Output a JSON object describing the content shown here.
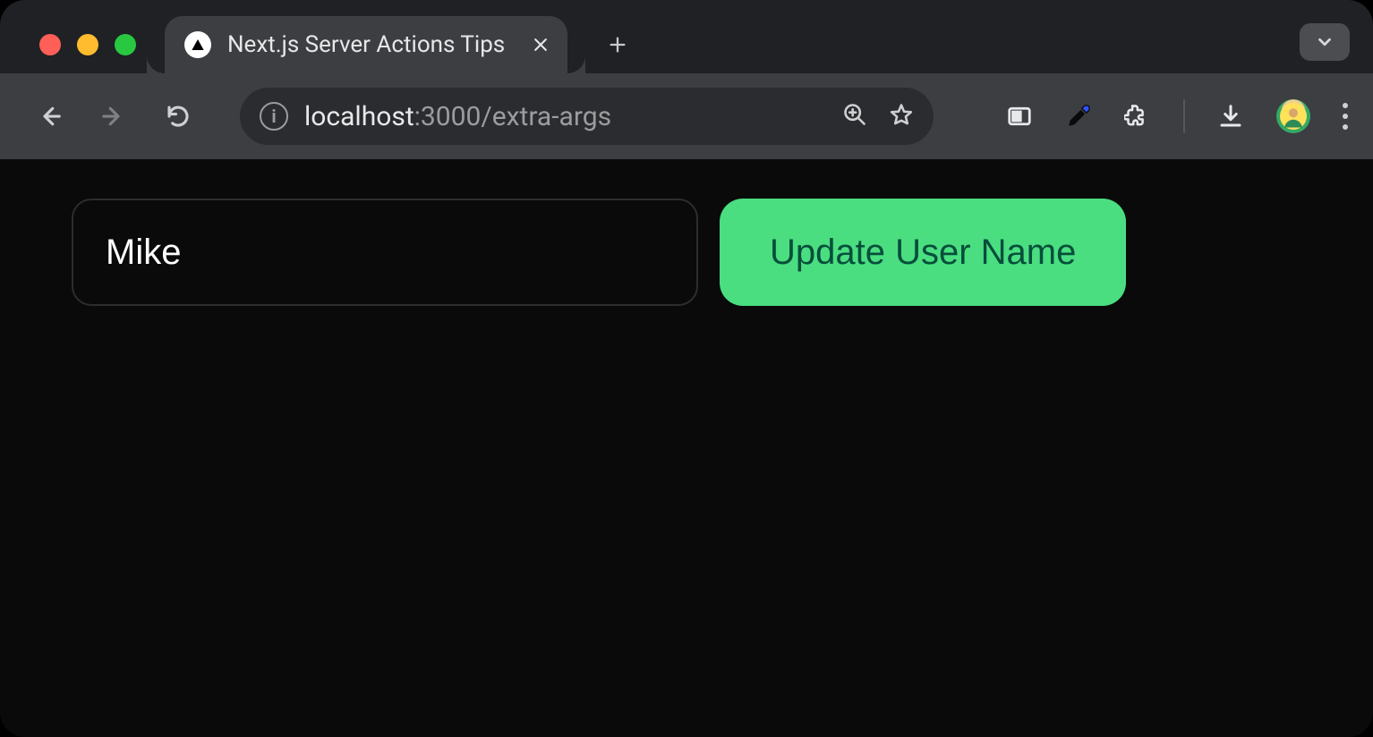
{
  "browser": {
    "tab": {
      "title": "Next.js Server Actions Tips"
    },
    "address": {
      "host": "localhost",
      "port_path": ":3000/extra-args"
    }
  },
  "page": {
    "name_input": {
      "value": "Mike"
    },
    "update_button_label": "Update User Name"
  }
}
